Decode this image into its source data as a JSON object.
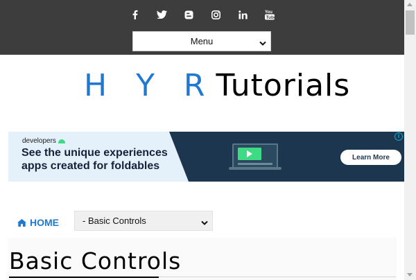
{
  "header": {
    "menu_select": {
      "selected": "Menu"
    },
    "social_icons": [
      "facebook-icon",
      "twitter-icon",
      "blogger-icon",
      "instagram-icon",
      "linkedin-icon",
      "youtube-icon"
    ]
  },
  "logo": {
    "part1": "H Y R",
    "part2": "Tutorials",
    "accent_color": "#1f78d1"
  },
  "ad": {
    "brand": "developers",
    "headline_line1": "See the unique experiences",
    "headline_line2": "apps created for foldables",
    "cta": "Learn More",
    "info_icon": "i"
  },
  "nav": {
    "home_label": "HOME",
    "category_select": {
      "selected": "- Basic Controls"
    }
  },
  "page": {
    "title": "Basic Controls"
  },
  "colors": {
    "topbar": "#3d3d3d",
    "link": "#1f78d1",
    "ad_dark": "#1d3650"
  }
}
